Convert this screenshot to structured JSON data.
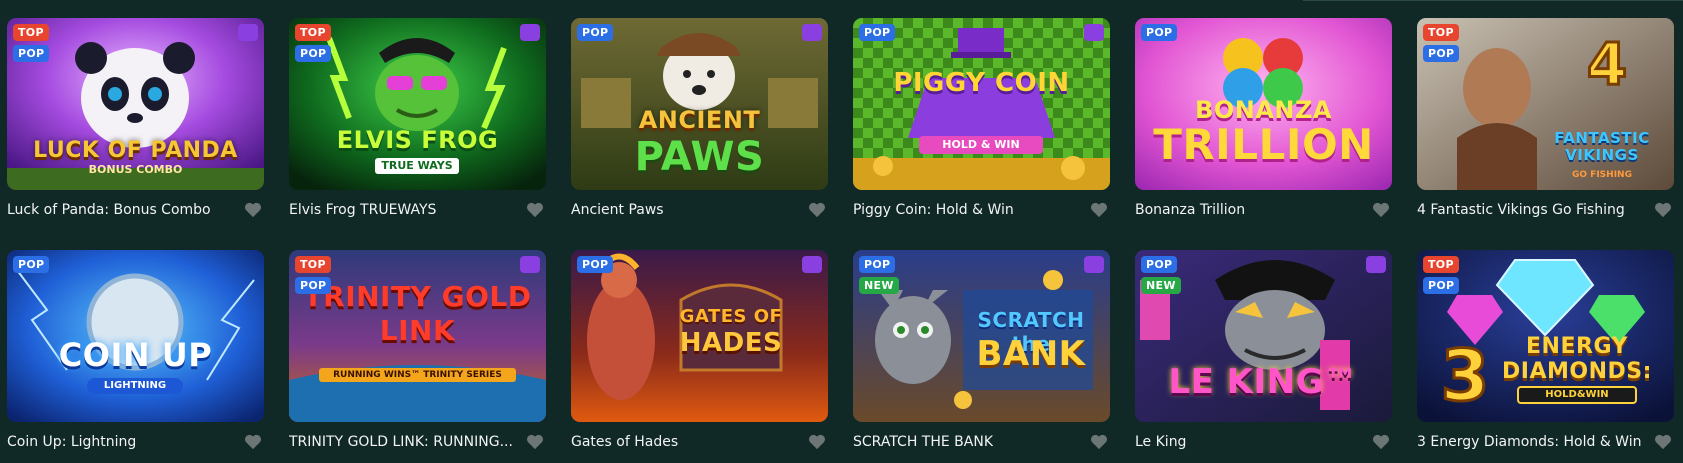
{
  "games": [
    {
      "title": "Luck of Panda: Bonus Combo",
      "badges": [
        "TOP",
        "POP"
      ],
      "crown": true,
      "art_title": "LUCK OF PANDA",
      "art_sub": "BONUS COMBO"
    },
    {
      "title": "Elvis Frog TRUEWAYS",
      "badges": [
        "TOP",
        "POP"
      ],
      "crown": true,
      "art_title": "ELVIS FROG",
      "art_sub": "TRUE WAYS"
    },
    {
      "title": "Ancient Paws",
      "badges": [
        "POP"
      ],
      "crown": true,
      "art_title": "ANCIENT",
      "art_sub": "PAWS"
    },
    {
      "title": "Piggy Coin: Hold & Win",
      "badges": [
        "POP"
      ],
      "crown": true,
      "art_title": "PIGGY COIN",
      "art_sub": "HOLD & WIN"
    },
    {
      "title": "Bonanza Trillion",
      "badges": [
        "POP"
      ],
      "crown": false,
      "art_title": "BONANZA",
      "art_sub": "TRILLION"
    },
    {
      "title": "4 Fantastic Vikings Go Fishing",
      "badges": [
        "TOP",
        "POP"
      ],
      "crown": false,
      "art_title": "FANTASTIC VIKINGS",
      "art_sub": "GO FISHING"
    },
    {
      "title": "Coin Up: Lightning",
      "badges": [
        "POP"
      ],
      "crown": false,
      "art_title": "COIN UP",
      "art_sub": "LIGHTNING"
    },
    {
      "title": "TRINITY GOLD LINK: RUNNING...",
      "badges": [
        "TOP",
        "POP"
      ],
      "crown": true,
      "art_title": "TRINITY GOLD LINK",
      "art_sub": "RUNNING WINS™ TRINITY SERIES"
    },
    {
      "title": "Gates of Hades",
      "badges": [
        "POP"
      ],
      "crown": true,
      "art_title": "GATES OF",
      "art_sub": "HADES"
    },
    {
      "title": "SCRATCH THE BANK",
      "badges": [
        "POP",
        "NEW"
      ],
      "crown": true,
      "art_title": "SCRATCH the",
      "art_sub": "BANK"
    },
    {
      "title": "Le King",
      "badges": [
        "POP",
        "NEW"
      ],
      "crown": true,
      "art_title": "LE KING™",
      "art_sub": ""
    },
    {
      "title": "3 Energy Diamonds: Hold & Win",
      "badges": [
        "TOP",
        "POP"
      ],
      "crown": false,
      "art_title": "ENERGY DIAMONDS:",
      "art_sub": "HOLD&WIN"
    }
  ],
  "icons": {
    "favorite": "heart-icon",
    "featured": "crown-icon"
  },
  "colors": {
    "background": "#102826",
    "badge_top": "#e8452f",
    "badge_pop": "#2b6ee6",
    "badge_new": "#27a847",
    "crown_bg": "#8a3fe0",
    "heart": "#6b7675"
  }
}
